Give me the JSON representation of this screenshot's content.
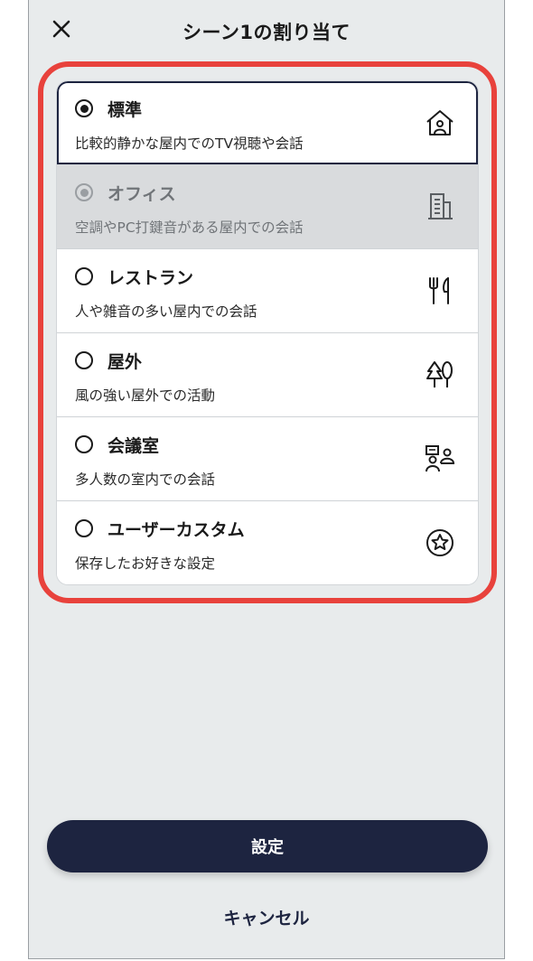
{
  "header": {
    "title": "シーン1の割り当て",
    "close_icon": "close-icon"
  },
  "options": [
    {
      "title": "標準",
      "desc": "比較的静かな屋内でのTV視聴や会話",
      "icon": "house-icon",
      "state": "selected"
    },
    {
      "title": "オフィス",
      "desc": "空調やPC打鍵音がある屋内での会話",
      "icon": "office-building-icon",
      "state": "disabled"
    },
    {
      "title": "レストラン",
      "desc": "人や雑音の多い屋内での会話",
      "icon": "fork-knife-icon",
      "state": "unselected"
    },
    {
      "title": "屋外",
      "desc": "風の強い屋外での活動",
      "icon": "trees-icon",
      "state": "unselected"
    },
    {
      "title": "会議室",
      "desc": "多人数の室内での会話",
      "icon": "meeting-people-icon",
      "state": "unselected"
    },
    {
      "title": "ユーザーカスタム",
      "desc": "保存したお好きな設定",
      "icon": "star-circle-icon",
      "state": "unselected"
    }
  ],
  "footer": {
    "submit_label": "設定",
    "cancel_label": "キャンセル"
  },
  "colors": {
    "primary": "#1d2440",
    "highlight": "#e8423c",
    "background": "#e8ebec"
  }
}
